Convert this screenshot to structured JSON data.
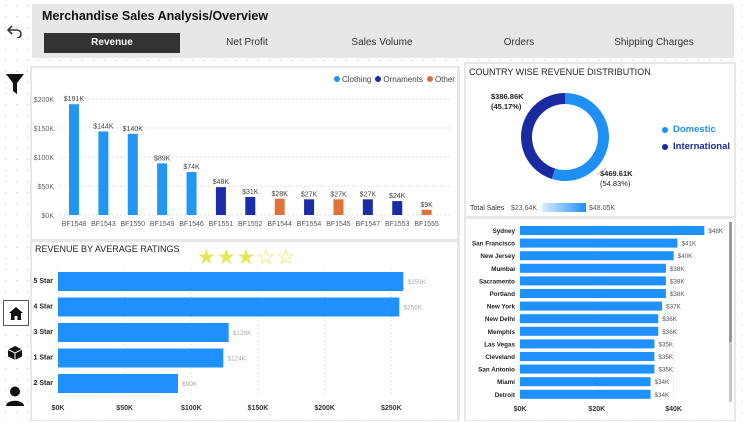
{
  "header": {
    "title": "Merchandise Sales Analysis/Overview"
  },
  "tabs": [
    {
      "label": "Revenue",
      "active": true
    },
    {
      "label": "Net Profit"
    },
    {
      "label": "Sales Volume"
    },
    {
      "label": "Orders"
    },
    {
      "label": "Shipping Charges"
    }
  ],
  "left_rail": {
    "icons": [
      "back-icon",
      "filter-icon",
      "home-icon",
      "box-icon",
      "user-icon"
    ]
  },
  "colors": {
    "clothing": "#2196f3",
    "ornaments": "#1c2ca6",
    "other": "#e0713a",
    "domestic": "#1e90f5",
    "international": "#1a2aa0"
  },
  "chart_data": [
    {
      "type": "bar",
      "title": "",
      "legend": [
        "Clothing",
        "Ornaments",
        "Other"
      ],
      "legend_position": "top-right",
      "categories": [
        "BF1548",
        "BF1543",
        "BF1550",
        "BF1549",
        "BF1546",
        "BF1551",
        "BF1552",
        "BF1544",
        "BF1554",
        "BF1545",
        "BF1547",
        "BF1553",
        "BF1555"
      ],
      "values": [
        191,
        144,
        140,
        89,
        74,
        48,
        31,
        28,
        27,
        27,
        27,
        24,
        9
      ],
      "value_labels": [
        "$191K",
        "$144K",
        "$140K",
        "$89K",
        "$74K",
        "$48K",
        "$31K",
        "$28K",
        "$27K",
        "$27K",
        "$27K",
        "$24K",
        "$9K"
      ],
      "groups": [
        "Clothing",
        "Clothing",
        "Clothing",
        "Clothing",
        "Clothing",
        "Ornaments",
        "Ornaments",
        "Other",
        "Ornaments",
        "Other",
        "Ornaments",
        "Ornaments",
        "Other"
      ],
      "y_ticks": [
        "$0K",
        "$50K",
        "$100K",
        "$150K",
        "$200K"
      ],
      "ylim": [
        0,
        200
      ],
      "grid": true
    },
    {
      "type": "bar",
      "orientation": "horizontal",
      "title": "REVENUE BY AVERAGE RATINGS",
      "categories": [
        "5 Star",
        "4 Star",
        "3 Star",
        "1 Star",
        "2 Star"
      ],
      "values": [
        259,
        256,
        128,
        124,
        90
      ],
      "value_labels": [
        "$259K",
        "$256K",
        "$128K",
        "$124K",
        "$90K"
      ],
      "x_ticks": [
        "$0K",
        "$50K",
        "$100K",
        "$150K",
        "$200K",
        "$250K"
      ],
      "xlim": [
        0,
        270
      ],
      "rating_stars": {
        "filled": 3,
        "total": 5
      }
    },
    {
      "type": "pie",
      "title": "COUNTRY WISE REVENUE DISTRIBUTION",
      "donut": true,
      "legend": [
        "Domestic",
        "International"
      ],
      "legend_position": "right",
      "slices": [
        {
          "name": "Domestic",
          "value": 469.61,
          "label": "$469.61K",
          "pct": "(54.83%)"
        },
        {
          "name": "International",
          "value": 386.86,
          "label": "$386.86K",
          "pct": "(45.17%)"
        }
      ],
      "gradient_legend": {
        "label": "Total Sales",
        "min": "$23.64K",
        "max": "$48.05K"
      }
    },
    {
      "type": "bar",
      "orientation": "horizontal",
      "categories": [
        "Sydney",
        "San Francisco",
        "New Jersey",
        "Mumbai",
        "Sacramento",
        "Portland",
        "New York",
        "New Delhi",
        "Memphis",
        "Las Vegas",
        "Cleveland",
        "San Antonio",
        "Miami",
        "Detroit"
      ],
      "values": [
        48,
        41,
        40,
        38,
        38,
        38,
        37,
        36,
        36,
        35,
        35,
        35,
        34,
        34
      ],
      "value_labels": [
        "$48K",
        "$41K",
        "$40K",
        "$38K",
        "$38K",
        "$38K",
        "$37K",
        "$36K",
        "$36K",
        "$35K",
        "$35K",
        "$35K",
        "$34K",
        "$34K"
      ],
      "x_ticks": [
        "$0K",
        "$20K",
        "$40K"
      ],
      "xlim": [
        0,
        50
      ]
    }
  ]
}
